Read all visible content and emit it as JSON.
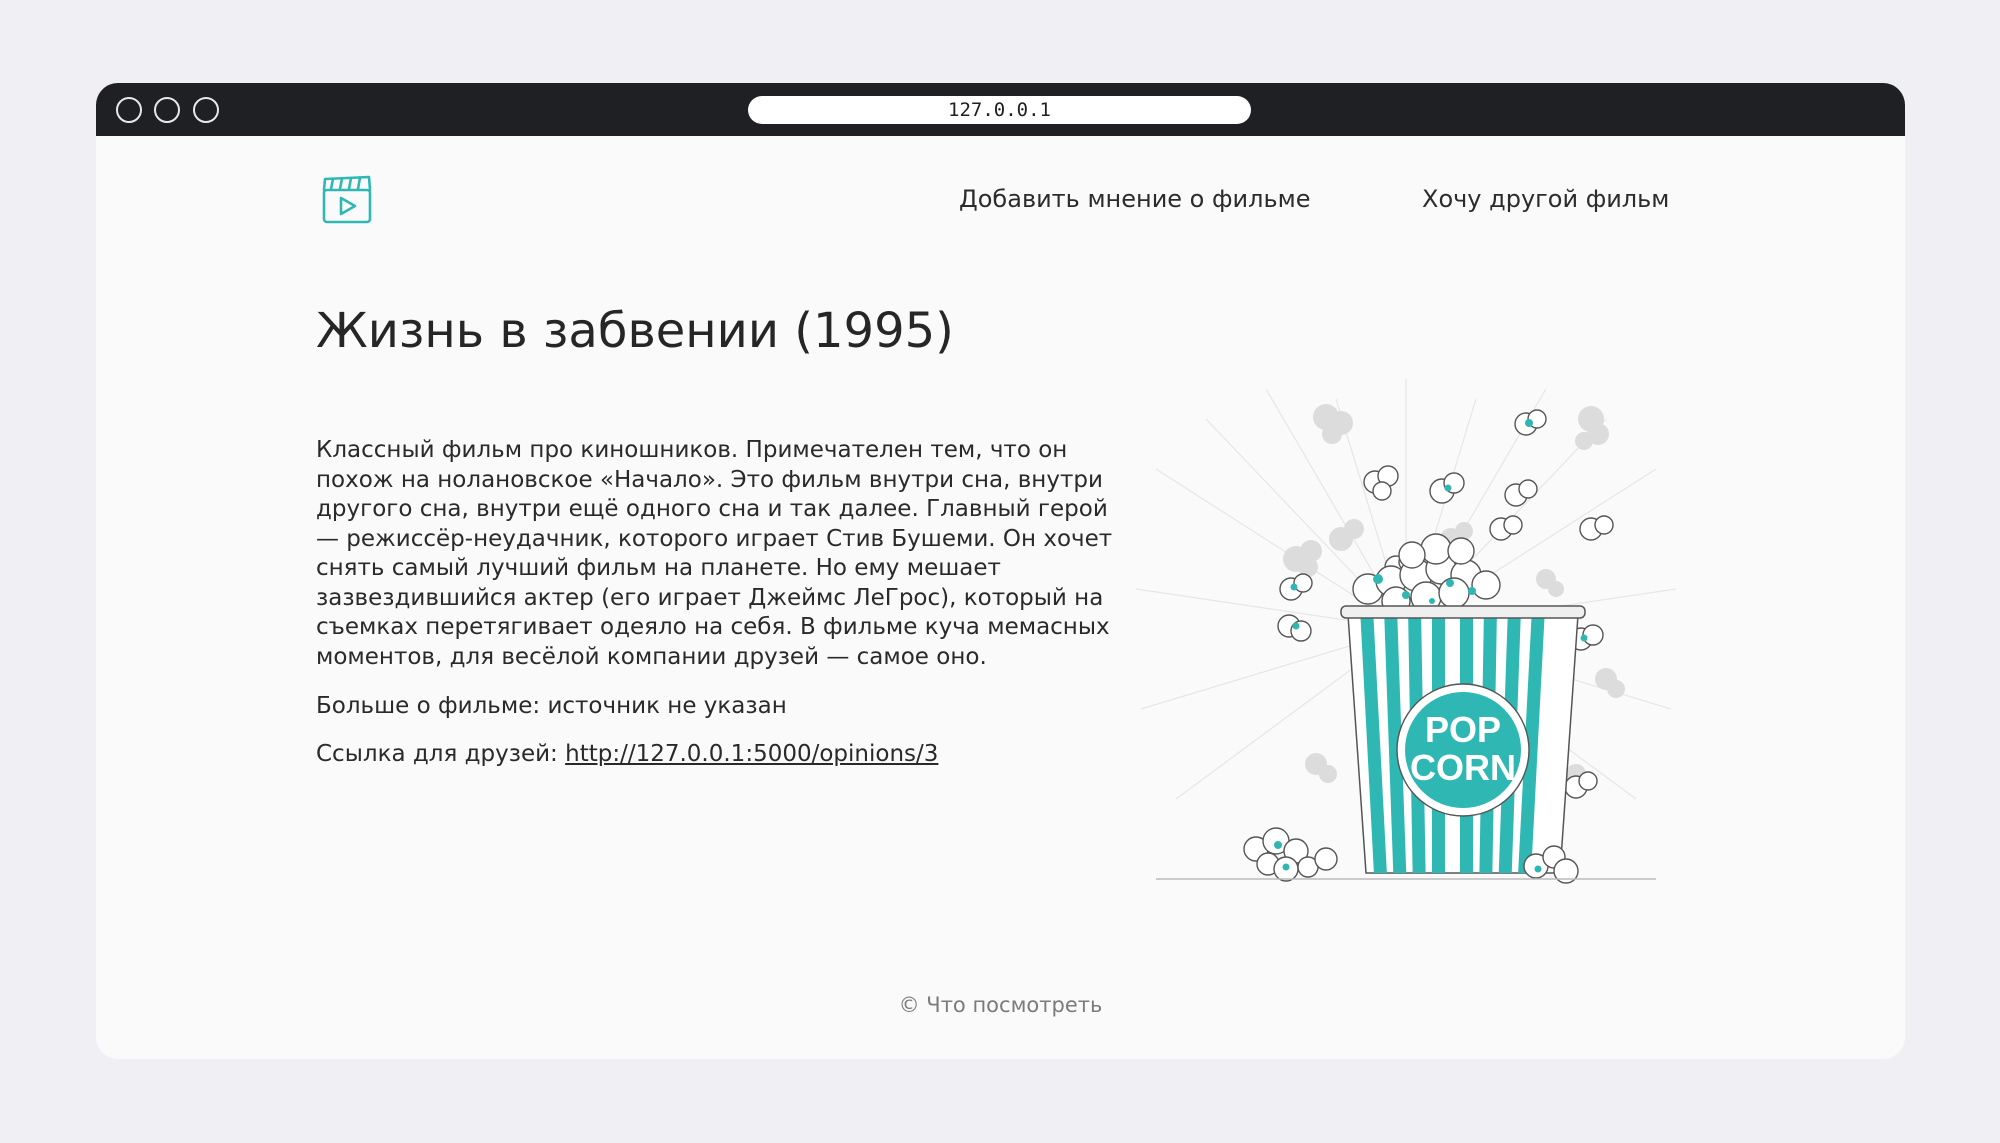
{
  "browser": {
    "address": "127.0.0.1"
  },
  "nav": {
    "add_opinion": "Добавить мнение о фильме",
    "another_film": "Хочу другой фильм"
  },
  "opinion": {
    "title": "Жизнь в забвении (1995)",
    "text": "Классный фильм про киношников. Примечателен тем, что он похож на нолановское «Начало». Это фильм внутри сна, внутри другого сна, внутри ещё одного сна и так далее. Главный герой — режиссёр-неудачник, которого играет Стив Бушеми. Он хочет снять самый лучший фильм на планете. Но ему мешает зазвездившийся актер (его играет Джеймс ЛеГрос), который на съемках перетягивает одеяло на себя. В фильме куча мемасных моментов, для весёлой компании друзей — самое оно.",
    "source_label": "Больше о фильме:",
    "source_value": "источник не указан",
    "link_label": "Ссылка для друзей:",
    "link_url": "http://127.0.0.1:5000/opinions/3"
  },
  "illustration": {
    "cup_line1": "POP",
    "cup_line2": "CORN"
  },
  "footer": {
    "copyright": "© Что посмотреть"
  },
  "colors": {
    "accent": "#2fb8b3",
    "titlebar": "#1f2023",
    "page_bg": "#fafafa",
    "outer_bg": "#f0eff4"
  },
  "icons": {
    "logo": "film-clapper-play-icon"
  }
}
